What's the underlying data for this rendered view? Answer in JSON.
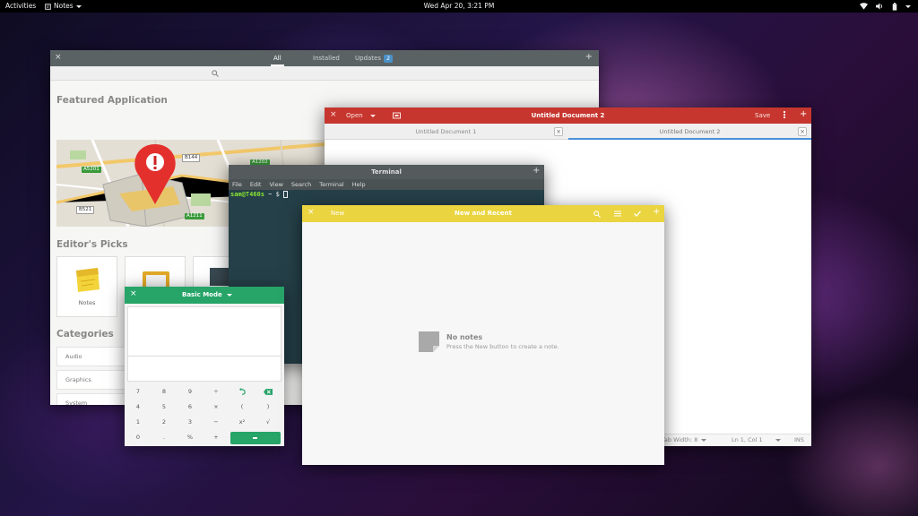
{
  "topbar": {
    "activities": "Activities",
    "app_menu": "Notes",
    "clock": "Wed Apr 20,  3:21 PM",
    "tray_icons": [
      "wifi-icon",
      "volume-icon",
      "battery-icon",
      "power-menu-icon"
    ]
  },
  "software": {
    "close": "×",
    "add": "+",
    "tabs": {
      "all": "All",
      "installed": "Installed",
      "updates": "Updates",
      "updates_count": "2"
    },
    "featured_heading": "Featured Application",
    "roads": {
      "a5201": "A5201",
      "b144": "B144",
      "a1202": "A1202",
      "b521": "B521",
      "a1211": "A1211"
    },
    "editors_picks_heading": "Editor's Picks",
    "picks": [
      {
        "label": "Notes"
      }
    ],
    "categories_heading": "Categories",
    "categories": [
      "Audio",
      "Graphics",
      "System"
    ]
  },
  "gedit": {
    "close": "×",
    "open_label": "Open",
    "title": "Untitled Document 2",
    "save_label": "Save",
    "add": "+",
    "tabs": [
      "Untitled Document 1",
      "Untitled Document 2"
    ],
    "tab_close": "×",
    "status": {
      "tab_width": "Tab Width: 8",
      "position": "Ln 1, Col 1",
      "mode": "INS"
    }
  },
  "terminal": {
    "title": "Terminal",
    "add": "+",
    "menu": [
      "File",
      "Edit",
      "View",
      "Search",
      "Terminal",
      "Help"
    ],
    "prompt_user": "sam@T460s",
    "prompt_rest": " ~ $ "
  },
  "calculator": {
    "close": "×",
    "mode": "Basic Mode",
    "keys": [
      "7",
      "8",
      "9",
      "÷",
      "4",
      "5",
      "6",
      "×",
      "(",
      ")",
      "1",
      "2",
      "3",
      "−",
      "x²",
      "√",
      "0",
      ".",
      "%",
      "+"
    ]
  },
  "notes": {
    "close": "×",
    "new_label": "New",
    "title": "New and Recent",
    "add": "+",
    "empty_title": "No notes",
    "empty_hint": "Press the New button to create a note."
  },
  "colors": {
    "software_header": "#5a6264",
    "gedit_header": "#c6362e",
    "terminal_header": "#555b5d",
    "calculator_header": "#27a468",
    "notes_header": "#ead43f"
  }
}
